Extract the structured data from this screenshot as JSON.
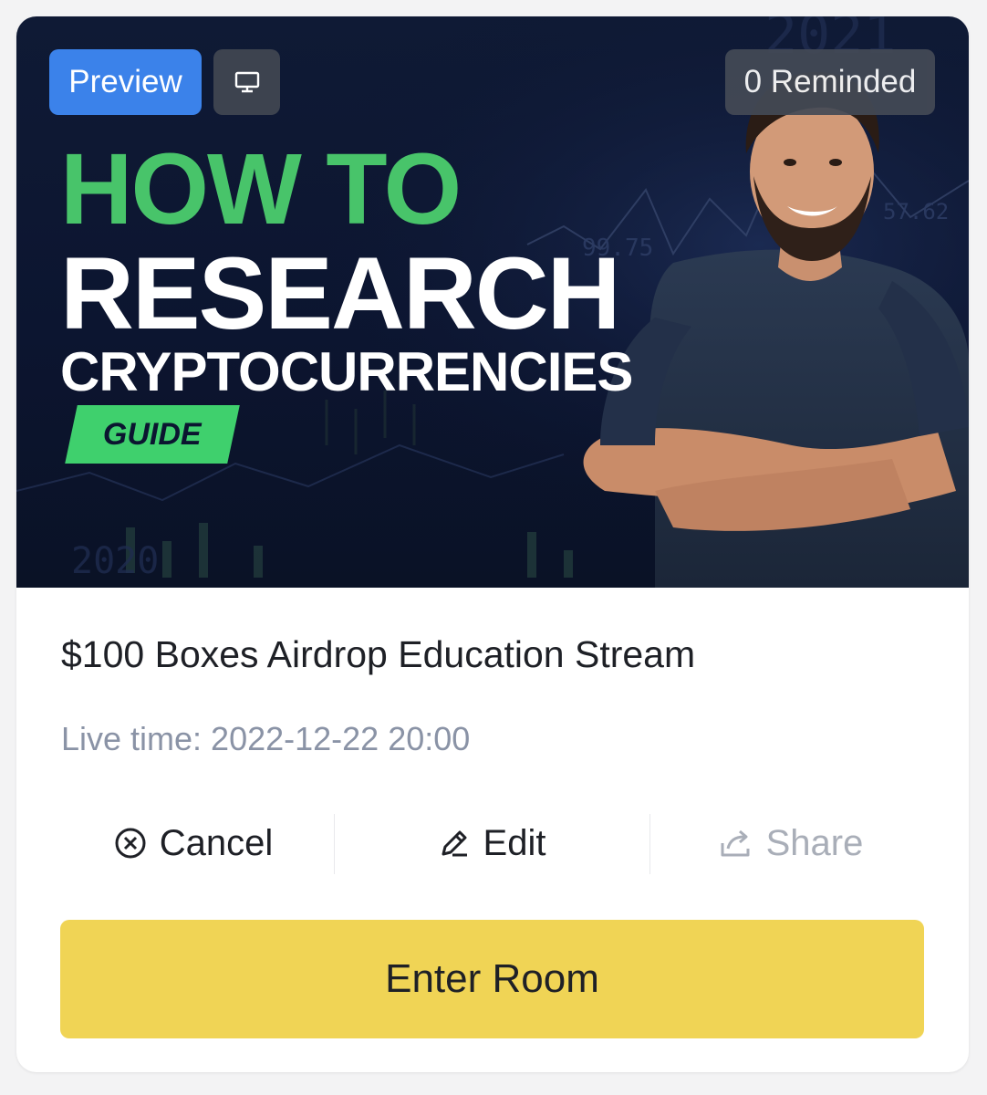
{
  "badges": {
    "preview_label": "Preview",
    "device_icon": "monitor-icon",
    "reminded_label": "0 Reminded"
  },
  "thumbnail": {
    "line1": "HOW TO",
    "line2": "RESEARCH",
    "line3": "CRYPTOCURRENCIES",
    "tag": "GUIDE",
    "bg_numbers": [
      "99.75",
      "57.62",
      "2021",
      "2020"
    ],
    "colors": {
      "green": "#48c46a",
      "navy": "#0f1a35"
    }
  },
  "stream": {
    "title": "$100 Boxes Airdrop Education Stream",
    "live_time": "Live time: 2022-12-22 20:00"
  },
  "actions": {
    "cancel_label": "Cancel",
    "cancel_icon": "circle-x-icon",
    "edit_label": "Edit",
    "edit_icon": "pencil-icon",
    "share_label": "Share",
    "share_icon": "share-icon"
  },
  "enter_room_label": "Enter Room",
  "colors": {
    "accent_blue": "#3b82ea",
    "enter_yellow": "#f0d455",
    "text_primary": "#1e2026",
    "text_secondary": "#8a93a6",
    "disabled": "#a9aeb8"
  }
}
